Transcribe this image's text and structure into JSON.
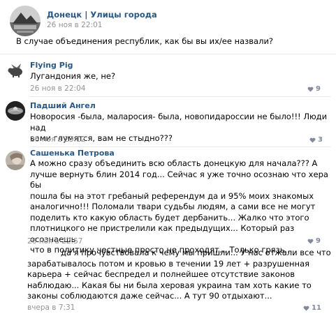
{
  "post": {
    "group_name": "Донецк | Улицы города",
    "date": "26 ноя в 22:01",
    "text": "В случае объединения республик, как бы вы их/ее назвали?"
  },
  "comments": [
    {
      "author": "Flying Pig",
      "text": "Лугандония же, не?",
      "date": "26 ноя в 22:04",
      "likes": "9"
    },
    {
      "author": "Падший Ангел",
      "lines": [
        "Новоросия -была, маларосия- была, новопидароссии не было!!! Люди над",
        "вами глумятся, вам не стыдно???"
      ],
      "date": "26 ноя в 23:12",
      "likes": "3"
    },
    {
      "author": "Сашенька Петрова",
      "lines": [
        "А можно сразу объединить всю область донецкую для начала??? А",
        "лучше вернуть блин 2014 год... Сейчас я уже точно осознаю что хера бы",
        "пошла бы на этот гребаный референдум да и 95% моих знакомых",
        "аналогично!!! Поломали твари судьбы людям, а сами все не могут",
        "поделить кто какую область будет дербанить... Жалко что этого",
        "плотницкого не пристрелили как предыдущих... Который раз осознаешь",
        "что в политику честные просто не проходят... Только грязь..."
      ],
      "date": "26 ноя в 22:57",
      "likes": "9"
    },
    {
      "author": "",
      "lines": [
        "да я прочувствовала к чему мы пришли... У нас отжали все что",
        "зарабатывалось потом и кровью в течении 19 лет + разрушенная",
        "карьера + сейчас беспредел и полнейшее отсутствие законов",
        "наблюдаю... Какая бы ни была херовая украина там хоть какие то",
        "законы соблюдаются даже сейчас... А тут 90 отдыхают..."
      ],
      "date": "вчера в 7:31",
      "likes": "11"
    }
  ],
  "colors": {
    "link": "#2a5885",
    "meta": "#939393",
    "heart": "#828a99",
    "divider": "#e7e8ec"
  },
  "icons": [
    "group-logo-icon",
    "pig-avatar-icon",
    "angel-avatar-icon",
    "user-photo-avatar",
    "heart-icon"
  ]
}
